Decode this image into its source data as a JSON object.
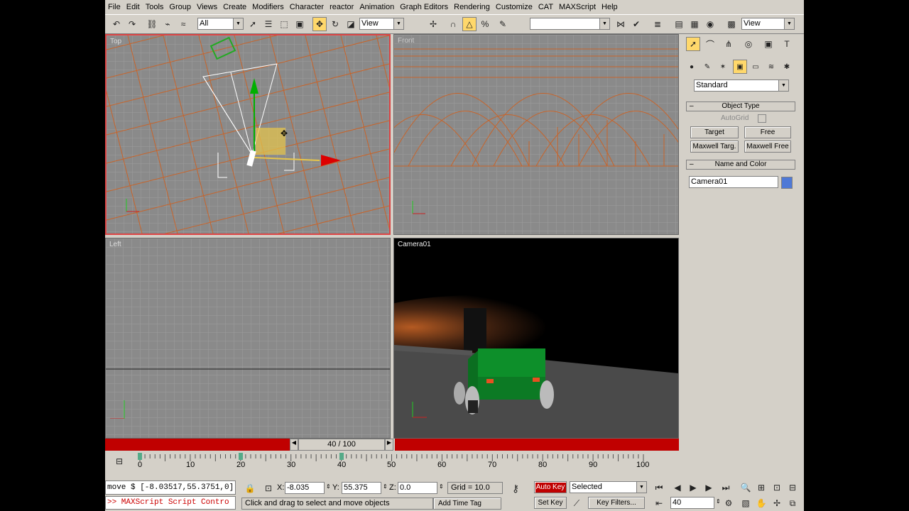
{
  "menu": [
    "File",
    "Edit",
    "Tools",
    "Group",
    "Views",
    "Create",
    "Modifiers",
    "Character",
    "reactor",
    "Animation",
    "Graph Editors",
    "Rendering",
    "Customize",
    "CAT",
    "MAXScript",
    "Help"
  ],
  "toolbar": {
    "selection_filter": "All",
    "ref_coord": "View",
    "named_selection": "",
    "ref_coord_right": "View"
  },
  "viewports": {
    "top": "Top",
    "front": "Front",
    "left": "Left",
    "camera": "Camera01"
  },
  "command_panel": {
    "category": "Standard",
    "object_type_title": "Object Type",
    "autogrid_label": "AutoGrid",
    "buttons": [
      "Target",
      "Free",
      "Maxwell Targ.",
      "Maxwell Free"
    ],
    "name_color_title": "Name and Color",
    "object_name": "Camera01",
    "object_color": "#4f79d6"
  },
  "time_slider": {
    "label": "40 / 100",
    "frame": 40,
    "total": 100
  },
  "track_bar": {
    "ticks": [
      "0",
      "10",
      "20",
      "30",
      "40",
      "50",
      "60",
      "70",
      "80",
      "90",
      "100"
    ]
  },
  "status": {
    "listener_line1": "move $ [-8.03517,55.3751,0]",
    "listener_line2": ">> MAXScript Script Contro",
    "x_label": "X:",
    "x": "-8.035",
    "y_label": "Y:",
    "y": "55.375",
    "z_label": "Z:",
    "z": "0.0",
    "grid": "Grid = 10.0",
    "prompt": "Click and drag to select and move objects",
    "add_time_tag": "Add Time Tag",
    "auto_key": "Auto Key",
    "set_key": "Set Key",
    "key_mode": "Selected",
    "key_filters": "Key Filters...",
    "current_frame": "40"
  },
  "colors": {
    "ui_bg": "#d4d0c8",
    "active_border": "#d44",
    "grid_orange": "#c8642a",
    "autokey_red": "#c00000"
  }
}
